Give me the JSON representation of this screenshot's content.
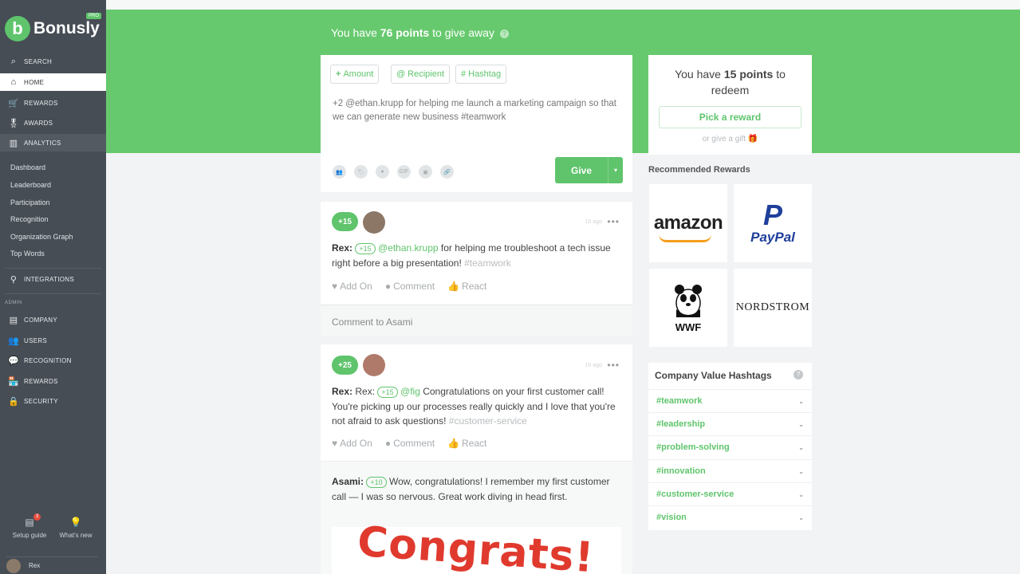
{
  "brand": {
    "name": "Bonusly",
    "badge": "PRO",
    "logo_letter": "b"
  },
  "sidebar": {
    "nav": [
      {
        "label": "Search",
        "icon": "search-icon",
        "glyph": "⌕"
      },
      {
        "label": "Home",
        "icon": "home-icon",
        "glyph": "⌂"
      },
      {
        "label": "Rewards",
        "icon": "cart-icon",
        "glyph": "🛒"
      },
      {
        "label": "Awards",
        "icon": "medal-icon",
        "glyph": "🎖"
      },
      {
        "label": "Analytics",
        "icon": "chart-icon",
        "glyph": "▥"
      }
    ],
    "analytics_sub": [
      "Dashboard",
      "Leaderboard",
      "Participation",
      "Recognition",
      "Organization Graph",
      "Top Words"
    ],
    "integrations": {
      "label": "Integrations",
      "glyph": "⚲"
    },
    "admin_label": "ADMIN",
    "admin": [
      {
        "label": "Company",
        "icon": "building-icon",
        "glyph": "▤"
      },
      {
        "label": "Users",
        "icon": "users-icon",
        "glyph": "👥"
      },
      {
        "label": "Recognition",
        "icon": "chat-icon",
        "glyph": "💬"
      },
      {
        "label": "Rewards",
        "icon": "store-icon",
        "glyph": "🏪"
      },
      {
        "label": "Security",
        "icon": "lock-icon",
        "glyph": "🔒"
      }
    ],
    "setup_guide": {
      "label": "Setup guide",
      "badge": "3"
    },
    "whats_new": {
      "label": "What's new"
    },
    "user": {
      "name": "Rex"
    }
  },
  "banner": {
    "prefix": "You have ",
    "points": "76 points",
    "suffix": " to give away",
    "help": "?"
  },
  "compose": {
    "chips": [
      {
        "glyph": "+",
        "label": "Amount"
      },
      {
        "glyph": "@",
        "label": "Recipient"
      },
      {
        "glyph": "#",
        "label": "Hashtag"
      }
    ],
    "text": "+2 @ethan.krupp for helping me launch a marketing campaign so that we can generate new business #teamwork",
    "tools": [
      "👥",
      "🏷",
      "●",
      "GIF",
      "▣",
      "🔗"
    ],
    "give_label": "Give",
    "give_caret": "▾"
  },
  "posts": [
    {
      "amount": "+15",
      "time": "1h ago",
      "more": "•••",
      "author": "Rex:",
      "mini": "+15",
      "mention": "@ethan.krupp",
      "body": " for helping me troubleshoot a tech issue right before a big presentation! ",
      "tag": "#teamwork",
      "actions": {
        "add_on": "Add On",
        "comment": "Comment",
        "react": "React"
      }
    },
    {
      "amount": "+25",
      "time": "1h ago",
      "more": "•••",
      "author": "Rex:",
      "author2": "Rex:",
      "mini": "+15",
      "mention": "@fig",
      "body": " Congratulations on your first customer call! You're picking up our processes really quickly and I love that you're not afraid to ask questions! ",
      "tag": "#customer-service",
      "actions": {
        "add_on": "Add On",
        "comment": "Comment",
        "react": "React"
      },
      "reply": {
        "author": "Asami:",
        "mini": "+10",
        "body": " Wow, congratulations! I remember my first customer call — I was so nervous. Great work diving in head first."
      },
      "gif_text": "Congrats!"
    }
  ],
  "comment_placeholder": "Comment to Asami",
  "redeem": {
    "prefix": "You have ",
    "points": "15 points",
    "suffix": " to redeem",
    "button": "Pick a reward",
    "gift_link": "or give a gift",
    "gift_glyph": "🎁"
  },
  "recommended": {
    "title": "Recommended Rewards",
    "items": [
      "amazon",
      "PayPal",
      "WWF",
      "NORDSTROM"
    ]
  },
  "hashtags": {
    "title": "Company Value Hashtags",
    "help": "?",
    "items": [
      "#teamwork",
      "#leadership",
      "#problem-solving",
      "#innovation",
      "#customer-service",
      "#vision"
    ]
  },
  "colors": {
    "brand_green": "#5fc46c",
    "banner_green": "#67c96e",
    "sidebar": "#464d55",
    "congrats_red": "#e03a2e"
  }
}
